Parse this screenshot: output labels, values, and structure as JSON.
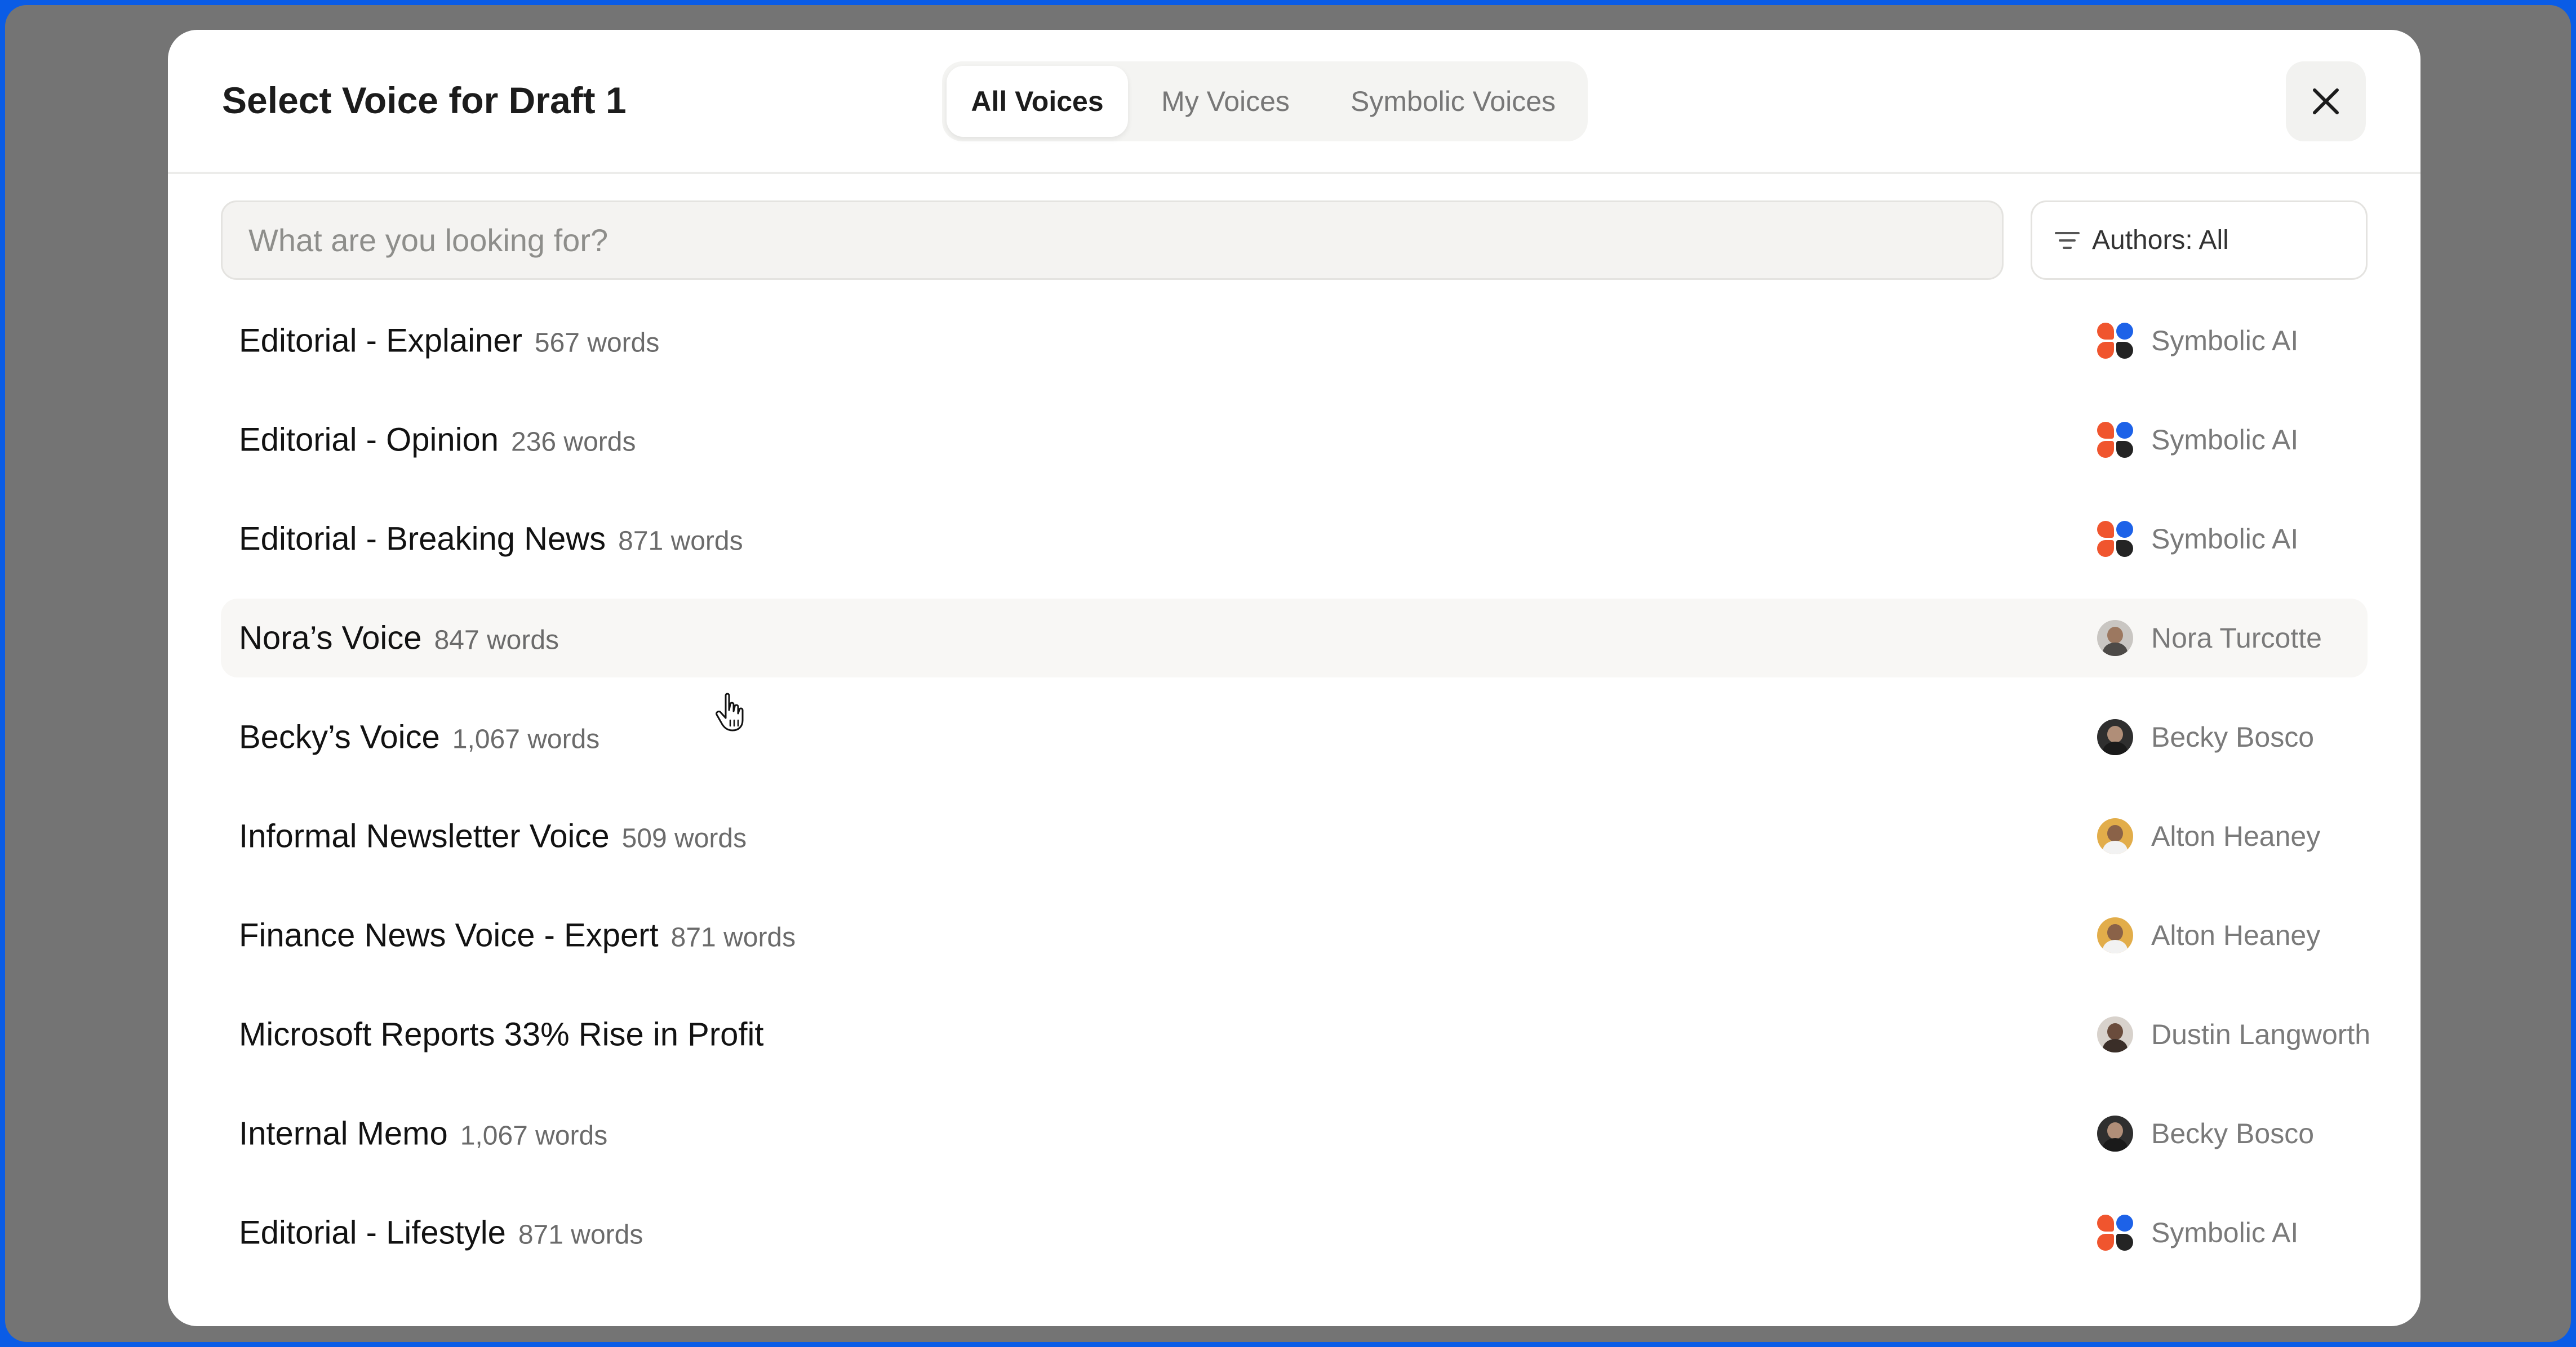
{
  "modal": {
    "title": "Select Voice for Draft 1",
    "tabs": [
      {
        "label": "All Voices",
        "active": true
      },
      {
        "label": "My Voices",
        "active": false
      },
      {
        "label": "Symbolic Voices",
        "active": false
      }
    ],
    "close_icon": "close-icon"
  },
  "search": {
    "placeholder": "What are you looking for?",
    "value": ""
  },
  "filter": {
    "label": "Authors: All",
    "icon": "filter-icon"
  },
  "voices": [
    {
      "name": "Editorial - Explainer",
      "words": "567 words",
      "author": "Symbolic AI",
      "author_icon": "symbolic-ai-logo"
    },
    {
      "name": "Editorial - Opinion",
      "words": "236 words",
      "author": "Symbolic AI",
      "author_icon": "symbolic-ai-logo"
    },
    {
      "name": "Editorial - Breaking News",
      "words": "871 words",
      "author": "Symbolic AI",
      "author_icon": "symbolic-ai-logo"
    },
    {
      "name": "Nora’s Voice",
      "words": "847 words",
      "author": "Nora Turcotte",
      "author_icon": "avatar"
    },
    {
      "name": "Becky’s Voice",
      "words": "1,067 words",
      "author": "Becky Bosco",
      "author_icon": "avatar"
    },
    {
      "name": "Informal Newsletter Voice",
      "words": "509 words",
      "author": "Alton Heaney",
      "author_icon": "avatar"
    },
    {
      "name": "Finance News Voice - Expert",
      "words": "871 words",
      "author": "Alton Heaney",
      "author_icon": "avatar"
    },
    {
      "name": "Microsoft Reports 33% Rise in Profit",
      "words": "",
      "author": "Dustin Langworth",
      "author_icon": "avatar"
    },
    {
      "name": "Internal Memo",
      "words": "1,067 words",
      "author": "Becky Bosco",
      "author_icon": "avatar"
    },
    {
      "name": "Editorial - Lifestyle",
      "words": "871 words",
      "author": "Symbolic AI",
      "author_icon": "symbolic-ai-logo"
    }
  ],
  "colors": {
    "frame": "#0a5ce6",
    "backdrop": "#747474",
    "logo_orange": "#f0552e",
    "logo_blue": "#1d62e8",
    "logo_dark": "#242424"
  }
}
